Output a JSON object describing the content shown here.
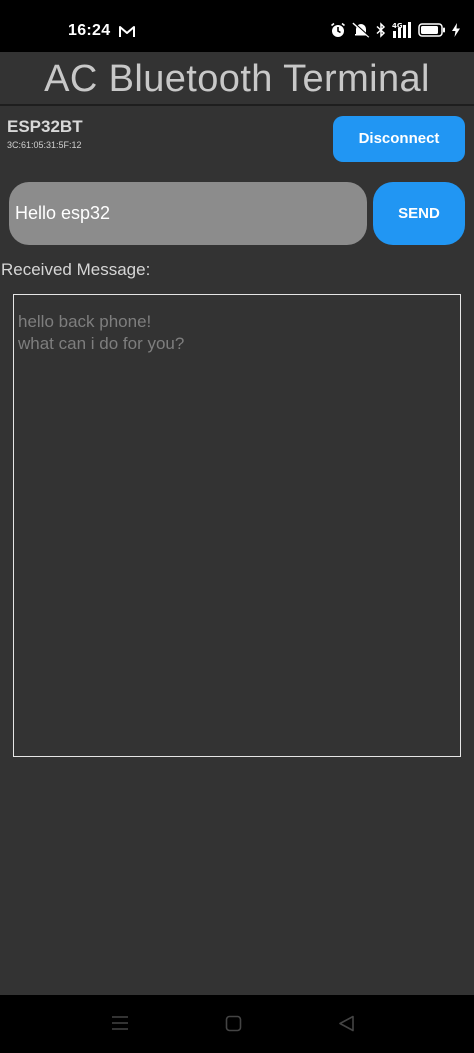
{
  "status_bar": {
    "time": "16:24",
    "network_label": "4G",
    "icons": [
      "gmail-icon",
      "alarm-icon",
      "mute-icon",
      "bluetooth-icon",
      "signal-icon",
      "battery-icon",
      "charging-icon"
    ]
  },
  "app": {
    "title": "AC Bluetooth Terminal"
  },
  "device": {
    "name": "ESP32BT",
    "mac": "3C:61:05:31:5F:12",
    "disconnect_label": "Disconnect"
  },
  "compose": {
    "value": "Hello esp32",
    "send_label": "SEND"
  },
  "received": {
    "label": "Received Message:",
    "lines": [
      "hello back phone!",
      "what can i do for you?"
    ]
  },
  "nav_bar": {
    "buttons": [
      "menu-icon",
      "home-icon",
      "back-icon"
    ]
  },
  "colors": {
    "background": "#333333",
    "accent": "#2196f3",
    "input_bg": "#8c8c8c"
  }
}
